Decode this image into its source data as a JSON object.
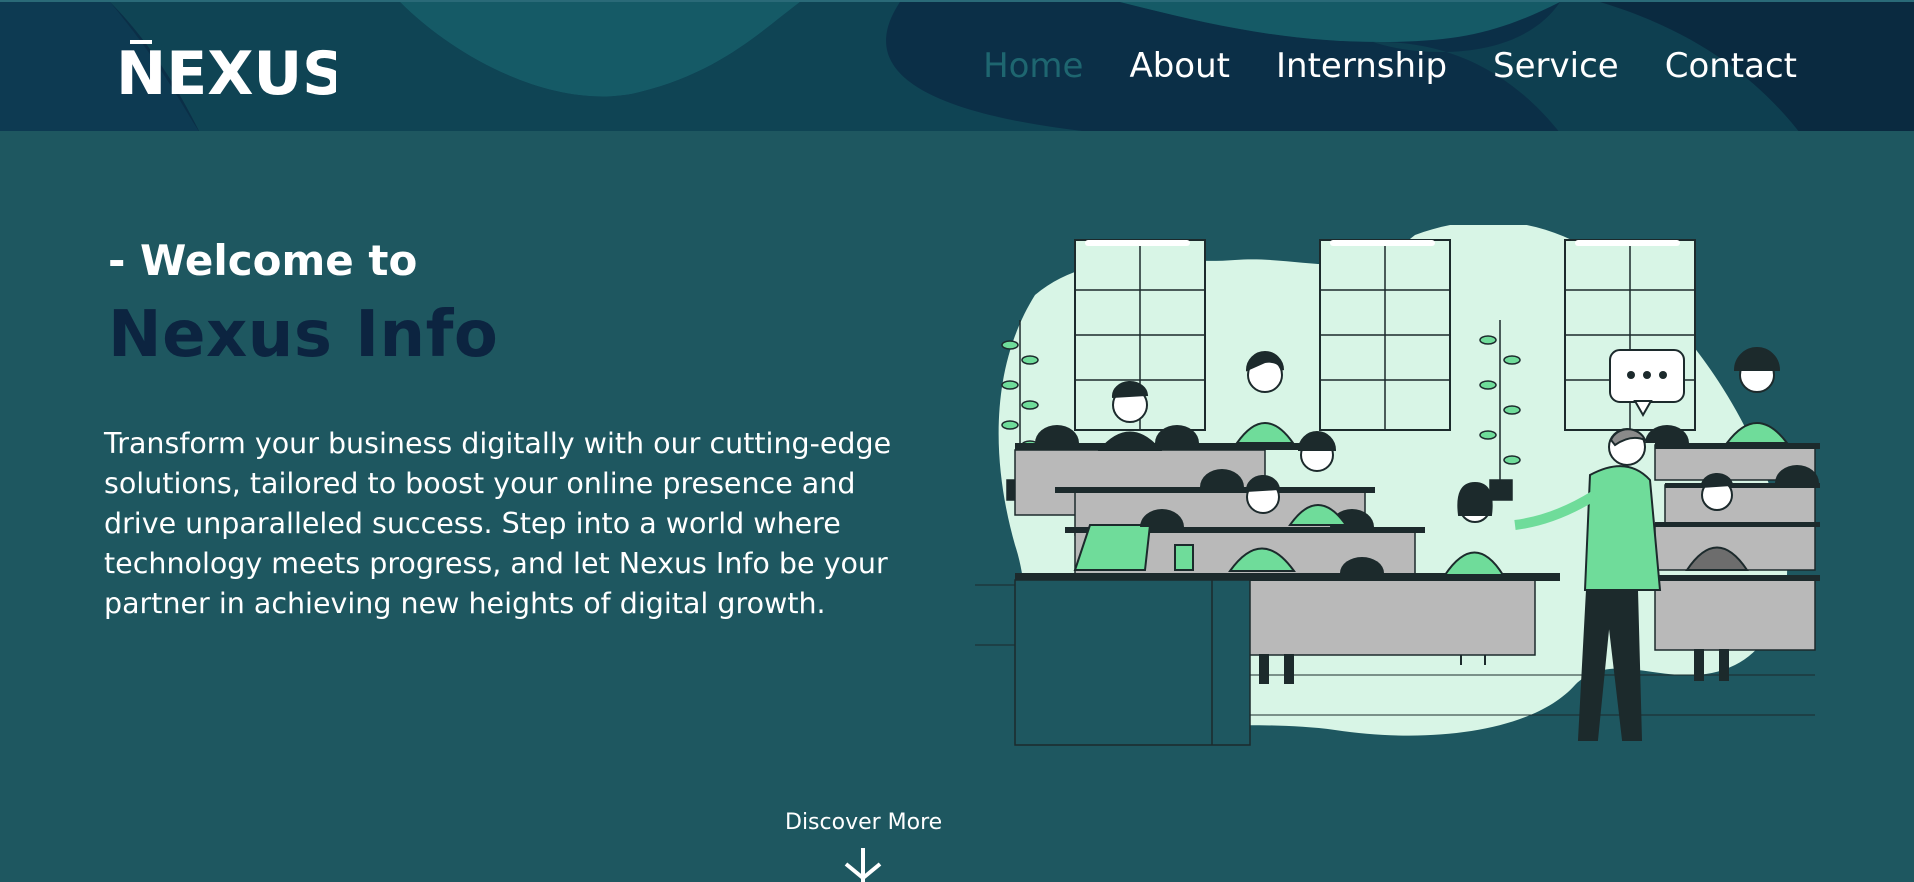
{
  "header": {
    "logo_text": "NEXUS",
    "nav": [
      {
        "label": "Home",
        "active": true
      },
      {
        "label": "About",
        "active": false
      },
      {
        "label": "Internship",
        "active": false
      },
      {
        "label": "Service",
        "active": false
      },
      {
        "label": "Contact",
        "active": false
      }
    ]
  },
  "hero": {
    "welcome": "- Welcome to",
    "title": "Nexus Info",
    "description": "Transform your business digitally with our cutting-edge solutions, tailored to boost your online presence and drive unparalleled success. Step into a world where technology meets progress, and let Nexus Info be your partner in achieving new heights of digital growth.",
    "illustration_icon": "classroom-illustration",
    "speech_bubble": "..."
  },
  "footer_cta": {
    "label": "Discover More",
    "icon": "arrow-down-icon"
  },
  "colors": {
    "page_bg": "#1e5760",
    "header_bg": "#0b2f47",
    "nav_active": "#1e6670",
    "title": "#0c2440",
    "accent_green": "#6fdc9a",
    "blob": "#d8f5e6"
  }
}
